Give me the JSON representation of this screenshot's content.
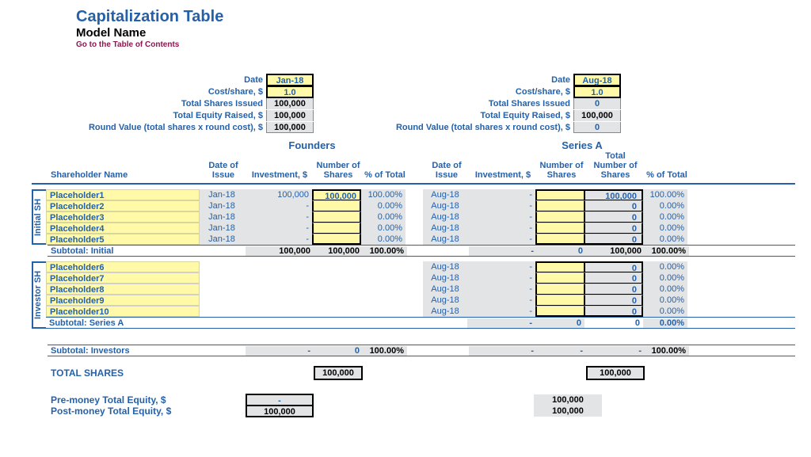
{
  "header": {
    "title": "Capitalization Table",
    "model": "Model Name",
    "toc_link": "Go to the Table of Contents"
  },
  "rounds": {
    "labels": {
      "date": "Date",
      "cost": "Cost/share, $",
      "tsi": "Total Shares Issued",
      "ter": "Total Equity Raised, $",
      "rv": "Round Value (total shares x round cost), $"
    },
    "founders": {
      "title": "Founders",
      "date": "Jan-18",
      "cost": "1.0",
      "tsi": "100,000",
      "ter": "100,000",
      "rv": "100,000"
    },
    "seriesA": {
      "title": "Series A",
      "date": "Aug-18",
      "cost": "1.0",
      "tsi": "0",
      "ter": "100,000",
      "rv": "0"
    }
  },
  "columns": {
    "shname": "Shareholder Name",
    "doi": "Date of Issue",
    "inv": "Investment, $",
    "ns": "Number of Shares",
    "pt": "% of Total",
    "tns": "Total Number of Shares"
  },
  "initial": {
    "label": "Initial SH",
    "rows": [
      {
        "name": "Placeholder1",
        "f": {
          "doi": "Jan-18",
          "inv": "100,000",
          "ns": "100,000",
          "pt": "100.00%"
        },
        "a": {
          "doi": "Aug-18",
          "inv": "-",
          "ns": "",
          "tns": "100,000",
          "pt": "100.00%"
        }
      },
      {
        "name": "Placeholder2",
        "f": {
          "doi": "Jan-18",
          "inv": "-",
          "ns": "",
          "pt": "0.00%"
        },
        "a": {
          "doi": "Aug-18",
          "inv": "-",
          "ns": "",
          "tns": "0",
          "pt": "0.00%"
        }
      },
      {
        "name": "Placeholder3",
        "f": {
          "doi": "Jan-18",
          "inv": "-",
          "ns": "",
          "pt": "0.00%"
        },
        "a": {
          "doi": "Aug-18",
          "inv": "-",
          "ns": "",
          "tns": "0",
          "pt": "0.00%"
        }
      },
      {
        "name": "Placeholder4",
        "f": {
          "doi": "Jan-18",
          "inv": "-",
          "ns": "",
          "pt": "0.00%"
        },
        "a": {
          "doi": "Aug-18",
          "inv": "-",
          "ns": "",
          "tns": "0",
          "pt": "0.00%"
        }
      },
      {
        "name": "Placeholder5",
        "f": {
          "doi": "Jan-18",
          "inv": "-",
          "ns": "",
          "pt": "0.00%"
        },
        "a": {
          "doi": "Aug-18",
          "inv": "-",
          "ns": "",
          "tns": "0",
          "pt": "0.00%"
        }
      }
    ],
    "subtotal_label": "Subtotal: Initial",
    "subtotal_f": {
      "inv": "100,000",
      "ns": "100,000",
      "pt": "100.00%"
    },
    "subtotal_a": {
      "inv": "-",
      "ns": "0",
      "tns": "100,000",
      "pt": "100.00%"
    }
  },
  "investor": {
    "label": "Investor SH",
    "rows": [
      {
        "name": "Placeholder6",
        "a": {
          "doi": "Aug-18",
          "inv": "-",
          "ns": "",
          "tns": "0",
          "pt": "0.00%"
        }
      },
      {
        "name": "Placeholder7",
        "a": {
          "doi": "Aug-18",
          "inv": "-",
          "ns": "",
          "tns": "0",
          "pt": "0.00%"
        }
      },
      {
        "name": "Placeholder8",
        "a": {
          "doi": "Aug-18",
          "inv": "-",
          "ns": "",
          "tns": "0",
          "pt": "0.00%"
        }
      },
      {
        "name": "Placeholder9",
        "a": {
          "doi": "Aug-18",
          "inv": "-",
          "ns": "",
          "tns": "0",
          "pt": "0.00%"
        }
      },
      {
        "name": "Placeholder10",
        "a": {
          "doi": "Aug-18",
          "inv": "-",
          "ns": "",
          "tns": "0",
          "pt": "0.00%"
        }
      }
    ],
    "subtotal_label": "Subtotal: Series A",
    "subtotal_a": {
      "inv": "-",
      "ns": "0",
      "tns": "0",
      "pt": "0.00%"
    }
  },
  "investors_total": {
    "label": "Subtotal: Investors",
    "f": {
      "inv": "-",
      "ns": "0",
      "pt": "100.00%"
    },
    "a": {
      "inv": "-",
      "ns": "-",
      "tns": "-",
      "pt": "100.00%"
    }
  },
  "totals": {
    "shares_label": "TOTAL SHARES",
    "shares_f": "100,000",
    "shares_a": "100,000",
    "pre_label": "Pre-money Total Equity, $",
    "post_label": "Post-money Total Equity, $",
    "pre_f": "-",
    "post_f": "100,000",
    "pre_a": "100,000",
    "post_a": "100,000"
  }
}
